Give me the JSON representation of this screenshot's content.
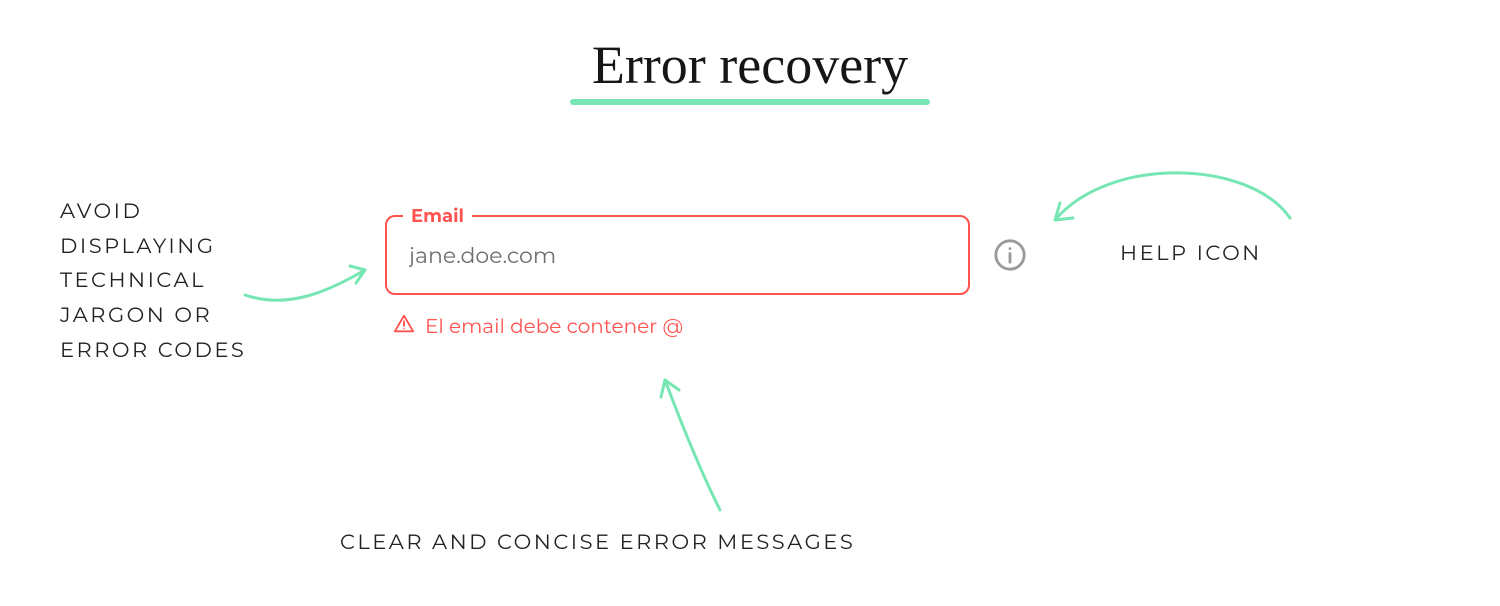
{
  "title": "Error recovery",
  "annotations": {
    "left": "AVOID DISPLAYING TECHNICAL JARGON OR ERROR CODES",
    "right": "HELP ICON",
    "bottom": "CLEAR AND CONCISE ERROR MESSAGES"
  },
  "field": {
    "label": "Email",
    "value": "jane.doe.com",
    "error_message": "El email debe contener @"
  },
  "colors": {
    "accent_green": "#76e6b3",
    "error_red": "#ff5350",
    "muted_grey": "#9a9a9a"
  }
}
